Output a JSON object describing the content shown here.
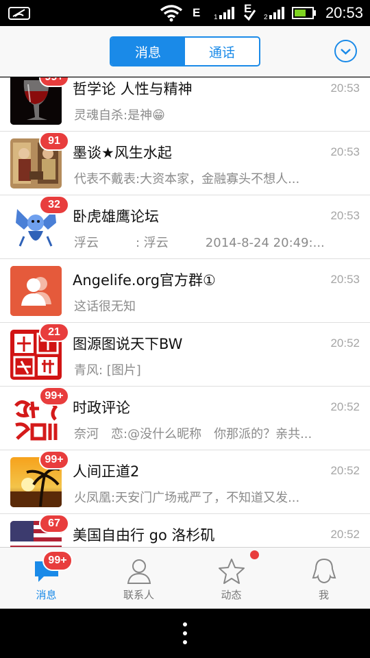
{
  "status_bar": {
    "time": "20:53",
    "network_1": "E",
    "network_2": "E"
  },
  "header": {
    "tabs": [
      {
        "label": "消息",
        "active": true
      },
      {
        "label": "通话",
        "active": false
      }
    ],
    "more_icon": "chevron-down-circle-icon"
  },
  "conversations": [
    {
      "name": "哲学论 人性与精神",
      "time": "20:53",
      "preview": "灵魂自杀:是神😁",
      "badge": "99+"
    },
    {
      "name": "墨谈★风生水起",
      "time": "20:53",
      "preview": "代表不戴表:大资本家，金融寡头不想人...",
      "badge": "91"
    },
    {
      "name": "卧虎雄鹰论坛",
      "time": "20:53",
      "preview": "浮云　　　: 浮云　　　2014-8-24 20:49:...",
      "badge": "32"
    },
    {
      "name": "Angelife.org官方群①",
      "time": "20:53",
      "preview": "这话很无知",
      "badge": ""
    },
    {
      "name": "图源图说天下BW",
      "time": "20:52",
      "preview": "青风: [图片]",
      "badge": "21"
    },
    {
      "name": "时政评论",
      "time": "20:52",
      "preview": "奈河　恋:@没什么昵称　你那派的？亲共...",
      "badge": "99+"
    },
    {
      "name": "人间正道2",
      "time": "20:52",
      "preview": "火凤凰:天安门广场戒严了，不知道又发...",
      "badge": "99+"
    },
    {
      "name": "美国自由行 go 洛杉矶",
      "time": "20:52",
      "preview": "",
      "badge": "67"
    }
  ],
  "tabbar": {
    "items": [
      {
        "label": "消息",
        "icon": "chat-bubble-icon",
        "badge": "99+"
      },
      {
        "label": "联系人",
        "icon": "contact-person-icon"
      },
      {
        "label": "动态",
        "icon": "star-icon"
      },
      {
        "label": "我",
        "icon": "penguin-icon"
      }
    ]
  },
  "colors": {
    "accent": "#1a8ae8",
    "badge": "#e83d3d"
  }
}
